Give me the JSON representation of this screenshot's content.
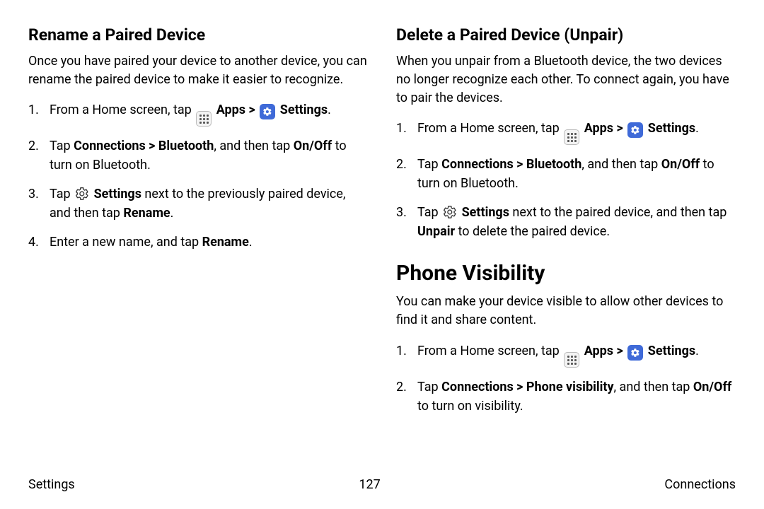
{
  "left": {
    "heading": "Rename a Paired Device",
    "intro": "Once you have paired your device to another device, you can rename the paired device to make it easier to recognize.",
    "step1_pre": "From a Home screen, tap ",
    "apps": "Apps",
    "gt": " > ",
    "settings": "Settings",
    "period": ".",
    "step2_a": "Tap ",
    "step2_b": "Connections > Bluetooth",
    "step2_c": ", and then tap ",
    "step2_d": "On/Off",
    "step2_e": " to turn on Bluetooth.",
    "step3_a": "Tap ",
    "step3_b": "Settings",
    "step3_c": " next to the previously paired device, and then tap ",
    "step3_d": "Rename",
    "step3_e": ".",
    "step4_a": "Enter a new name, and tap ",
    "step4_b": "Rename",
    "step4_c": "."
  },
  "right": {
    "heading": "Delete a Paired Device (Unpair)",
    "intro": "When you unpair from a Bluetooth device, the two devices no longer recognize each other. To connect again, you have to pair the devices.",
    "step1_pre": "From a Home screen, tap ",
    "apps": "Apps",
    "gt": " > ",
    "settings": "Settings",
    "period": ".",
    "step2_a": "Tap ",
    "step2_b": "Connections > Bluetooth",
    "step2_c": ", and then tap ",
    "step2_d": "On/Off",
    "step2_e": " to turn on Bluetooth.",
    "step3_a": "Tap ",
    "step3_b": "Settings",
    "step3_c": " next to the paired device, and then tap ",
    "step3_d": "Unpair",
    "step3_e": " to delete the paired device."
  },
  "pv": {
    "heading": "Phone Visibility",
    "intro": "You can make your device visible to allow other devices to find it and share content.",
    "step1_pre": "From a Home screen, tap ",
    "apps": "Apps",
    "gt": " > ",
    "settings": "Settings",
    "period": ".",
    "step2_a": "Tap ",
    "step2_b": "Connections > Phone visibility",
    "step2_c": ", and then tap ",
    "step2_d": "On/Off",
    "step2_e": " to turn on visibility."
  },
  "footer": {
    "left": "Settings",
    "center": "127",
    "right": "Connections"
  }
}
